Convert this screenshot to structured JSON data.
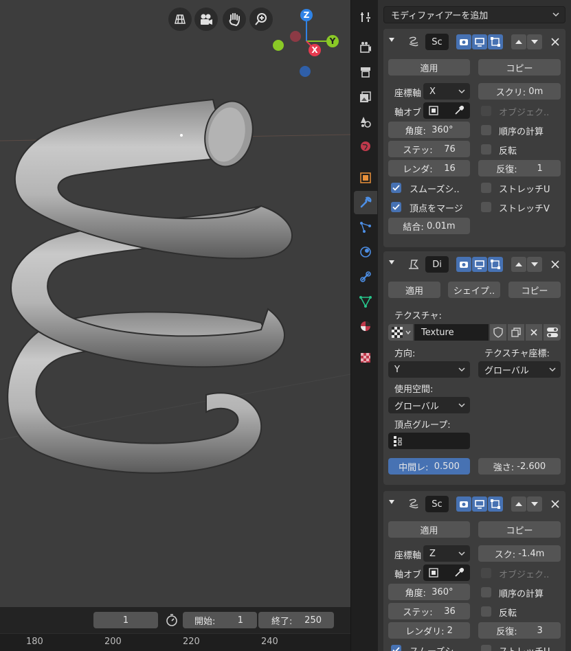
{
  "viewport": {
    "nav_icons": [
      "grid-icon",
      "camera-icon",
      "hand-icon",
      "zoom-icon"
    ],
    "gizmo": {
      "z": "Z",
      "y": "Y",
      "x": "X"
    }
  },
  "timeline": {
    "current_frame": "1",
    "start_label": "開始:",
    "start_value": "1",
    "end_label": "終了:",
    "end_value": "250",
    "ruler": [
      "180",
      "200",
      "220",
      "240"
    ]
  },
  "properties": {
    "add_modifier": "モディファイアーを追加",
    "modifiers": [
      {
        "name": "Sc",
        "apply": "適用",
        "copy": "コピー",
        "axis_label": "座標軸",
        "axis_value": "X",
        "screw_label": "スクリ:",
        "screw_value": "0m",
        "axis_object_label": "軸オブ",
        "object_screw_label": "オブジェク..",
        "angle_label": "角度:",
        "angle_value": "360°",
        "calc_order_label": "順序の計算",
        "steps_label": "ステッ:",
        "steps_value": "76",
        "flip_label": "反転",
        "render_label": "レンダ:",
        "render_value": "16",
        "iterations_label": "反復:",
        "iterations_value": "1",
        "smooth_label": "スムーズシ..",
        "stretch_u_label": "ストレッチU",
        "merge_label": "頂点をマージ",
        "stretch_v_label": "ストレッチV",
        "merge_dist_label": "結合:",
        "merge_dist_value": "0.01m"
      },
      {
        "name": "Di",
        "apply": "適用",
        "shape": "シェイプ..",
        "copy": "コピー",
        "texture_label": "テクスチャ:",
        "texture_value": "Texture",
        "direction_label": "方向:",
        "direction_value": "Y",
        "tex_coords_label": "テクスチャ座標:",
        "tex_coords_value": "グローバル",
        "space_label": "使用空間:",
        "space_value": "グローバル",
        "vgroup_label": "頂点グループ:",
        "midlevel_label": "中間レ:",
        "midlevel_value": "0.500",
        "strength_label": "強さ:",
        "strength_value": "-2.600"
      },
      {
        "name": "Sc",
        "apply": "適用",
        "copy": "コピー",
        "axis_label": "座標軸",
        "axis_value": "Z",
        "screw_label": "スク:",
        "screw_value": "-1.4m",
        "axis_object_label": "軸オブ",
        "object_screw_label": "オブジェク..",
        "angle_label": "角度:",
        "angle_value": "360°",
        "calc_order_label": "順序の計算",
        "steps_label": "ステッ:",
        "steps_value": "36",
        "flip_label": "反転",
        "render_label": "レンダリ:",
        "render_value": "2",
        "iterations_label": "反復:",
        "iterations_value": "3",
        "smooth_label": "スムーズシ..",
        "stretch_u_label": "ストレッチU"
      }
    ]
  },
  "colors": {
    "accent": "#4772b3",
    "panel": "#3d3d3d",
    "button": "#545454",
    "gizmo_x": "#e63a4f",
    "gizmo_y": "#8ac926",
    "gizmo_z": "#2f83e6"
  }
}
